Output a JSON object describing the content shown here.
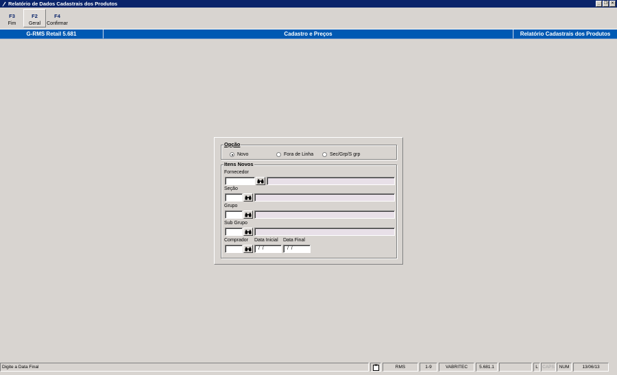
{
  "window": {
    "title": "Relatório de Dados Cadastrais dos Produtos",
    "icon": "pen-icon"
  },
  "toolbar": {
    "keys": [
      {
        "key": "F3",
        "label": "Fim"
      },
      {
        "key": "F2",
        "label": "Geral"
      },
      {
        "key": "F4",
        "label": "Confirmar"
      }
    ]
  },
  "header": {
    "app": "G-RMS Retail 5.681",
    "module": "Cadastro e Preços",
    "screen": "Relatório Cadastrais dos Produtos"
  },
  "opcao": {
    "title": "Opção",
    "options": [
      {
        "label": "Novo",
        "selected": true
      },
      {
        "label": "Fora de Linha",
        "selected": false
      },
      {
        "label": "Sec/Grp/S grp",
        "selected": false
      }
    ]
  },
  "itens": {
    "title": "Itens Novos",
    "fornecedor_label": "Fornecedor",
    "secao_label": "Seção",
    "grupo_label": "Grupo",
    "subgrupo_label": "Sub Grupo",
    "comprador_label": "Comprador",
    "data_inicial_label": "Data Inicial",
    "data_final_label": "Data Final",
    "data_inicial_value": " /  /",
    "data_final_value": " /  /"
  },
  "status": {
    "message": "Digite a Data Final",
    "system": "RMS",
    "range": "1-9",
    "company": "VABRITEC",
    "version": "5.681.1",
    "l": "L",
    "caps": "CAPS",
    "num": "NUM",
    "date": "13/06/13"
  },
  "colors": {
    "titlebar": "#0a246a",
    "band": "#0059b3",
    "background": "#d8d4d0"
  }
}
